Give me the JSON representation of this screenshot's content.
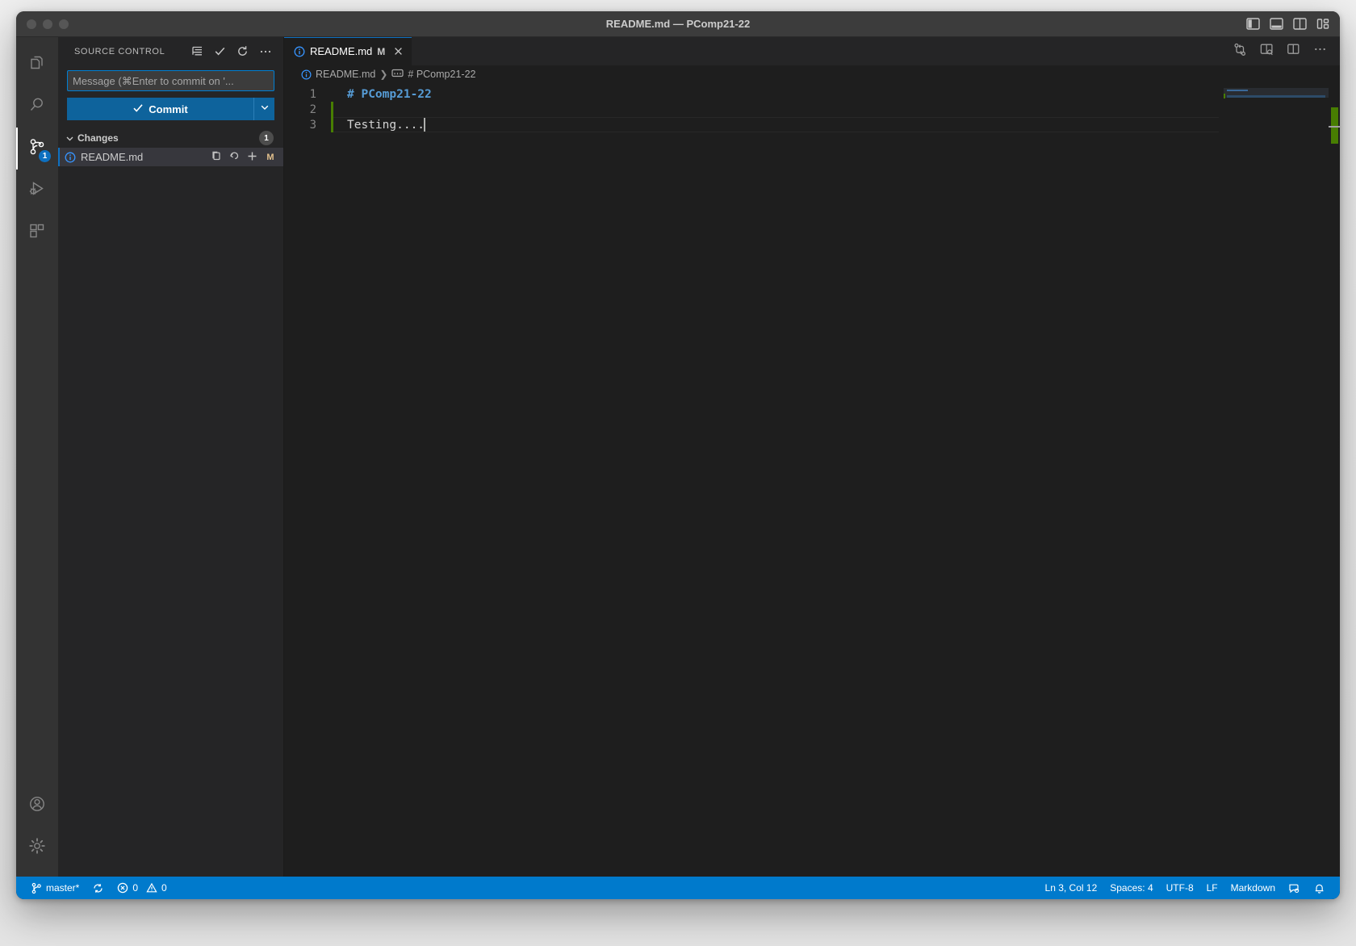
{
  "window": {
    "title": "README.md — PComp21-22",
    "traffic_lights": [
      "close-button",
      "minimize-button",
      "zoom-button"
    ]
  },
  "titlebar_layout_controls": [
    {
      "name": "toggle-primary-sidebar",
      "label": "Toggle Primary Side Bar"
    },
    {
      "name": "toggle-panel",
      "label": "Toggle Panel"
    },
    {
      "name": "toggle-secondary-sidebar",
      "label": "Toggle Secondary Side Bar"
    },
    {
      "name": "customize-layout",
      "label": "Customize Layout"
    }
  ],
  "activity_bar": {
    "items": [
      {
        "name": "explorer",
        "icon": "files-icon",
        "active": false,
        "badge": null
      },
      {
        "name": "search",
        "icon": "search-icon",
        "active": false,
        "badge": null
      },
      {
        "name": "source-control",
        "icon": "source-control-icon",
        "active": true,
        "badge": "1"
      },
      {
        "name": "run-and-debug",
        "icon": "run-debug-icon",
        "active": false,
        "badge": null
      },
      {
        "name": "extensions",
        "icon": "extensions-icon",
        "active": false,
        "badge": null
      }
    ],
    "bottom_items": [
      {
        "name": "accounts",
        "icon": "account-icon"
      },
      {
        "name": "manage-settings",
        "icon": "gear-icon"
      }
    ]
  },
  "sidebar": {
    "title": "SOURCE CONTROL",
    "header_actions": [
      {
        "name": "view-as-tree",
        "icon": "list-icon"
      },
      {
        "name": "commit-check",
        "icon": "check-icon"
      },
      {
        "name": "refresh",
        "icon": "refresh-icon"
      },
      {
        "name": "more-actions",
        "icon": "ellipsis-icon"
      }
    ],
    "commit_input": {
      "value": "",
      "placeholder": "Message (⌘Enter to commit on '..."
    },
    "commit_button": {
      "label": "Commit",
      "icon": "check-icon",
      "dropdown_icon": "chevron-down-icon"
    },
    "changes_section": {
      "label": "Changes",
      "count": "1",
      "expanded": true,
      "rows": [
        {
          "filename": "README.md",
          "status_letter": "M",
          "icon": "info-icon",
          "actions": [
            {
              "name": "open-changes",
              "icon": "open-file-icon"
            },
            {
              "name": "discard-changes",
              "icon": "discard-icon"
            },
            {
              "name": "stage-changes",
              "icon": "plus-icon"
            }
          ]
        }
      ]
    }
  },
  "editor": {
    "tab": {
      "filename": "README.md",
      "dirty_indicator": "M",
      "icon": "info-icon",
      "close_icon": "close-icon"
    },
    "actions": [
      {
        "name": "open-changes",
        "icon": "compare-changes-icon"
      },
      {
        "name": "open-preview-to-side",
        "icon": "preview-side-icon"
      },
      {
        "name": "split-editor-right",
        "icon": "split-editor-icon"
      },
      {
        "name": "more-actions",
        "icon": "ellipsis-icon"
      }
    ],
    "breadcrumbs": [
      {
        "label": "README.md",
        "icon": "info-icon"
      },
      {
        "label": "# PComp21-22",
        "icon": "symbol-string-icon"
      }
    ],
    "lines": [
      {
        "number": "1",
        "text": "# PComp21-22",
        "kind": "heading",
        "modified": false
      },
      {
        "number": "2",
        "text": "",
        "kind": "plain",
        "modified": true
      },
      {
        "number": "3",
        "text": "Testing....",
        "kind": "plain",
        "modified": true,
        "cursor": true,
        "current": true
      }
    ]
  },
  "status_bar": {
    "left": [
      {
        "name": "git-branch",
        "icon": "branch-icon",
        "label": "master*"
      },
      {
        "name": "sync-changes",
        "icon": "sync-icon",
        "label": ""
      },
      {
        "name": "problems",
        "icon": "error-warning-icon",
        "label": "0",
        "label2": "0"
      }
    ],
    "right": [
      {
        "name": "editor-position",
        "label": "Ln 3, Col 12"
      },
      {
        "name": "editor-indentation",
        "label": "Spaces: 4"
      },
      {
        "name": "editor-encoding",
        "label": "UTF-8"
      },
      {
        "name": "editor-eol",
        "label": "LF"
      },
      {
        "name": "editor-language",
        "label": "Markdown"
      },
      {
        "name": "send-feedback",
        "icon": "feedback-icon",
        "label": ""
      },
      {
        "name": "notifications",
        "icon": "bell-icon",
        "label": ""
      }
    ]
  },
  "colors": {
    "accent": "#007acc",
    "button": "#0e639c",
    "heading_token": "#569cd6",
    "modified_gutter": "#487e02",
    "status_letter": "#e2c08d"
  }
}
